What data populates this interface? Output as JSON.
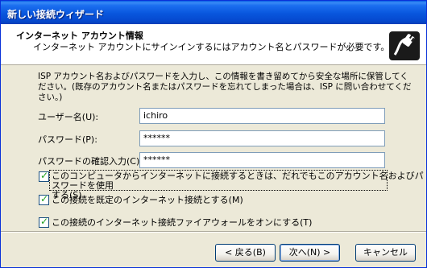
{
  "window": {
    "title": "新しい接続ウィザード"
  },
  "header": {
    "title": "インターネット アカウント情報",
    "subtitle": "インターネット アカウントにサインインするにはアカウント名とパスワードが必要です。",
    "icon": "network-plug-icon"
  },
  "description": "ISP アカウント名およびパスワードを入力し、この情報を書き留めてから安全な場所に保管してください。(既存のアカウント名またはパスワードを忘れてしまった場合は、ISP に問い合わせてください。)",
  "fields": {
    "username": {
      "label": "ユーザー名(U):",
      "value": "ichiro"
    },
    "password": {
      "label": "パスワード(P):",
      "value": "******"
    },
    "confirm": {
      "label": "パスワードの確認入力(C):",
      "value": "******"
    }
  },
  "checkboxes": [
    {
      "label_line1": "このコンピュータからインターネットに接続するときは、だれでもこのアカウント名およびパスワードを使用",
      "label_line2": "する(S)",
      "checked": true
    },
    {
      "label_line1": "この接続を既定のインターネット接続とする(M)",
      "label_line2": "",
      "checked": true
    },
    {
      "label_line1": "この接続のインターネット接続ファイアウォールをオンにする(T)",
      "label_line2": "",
      "checked": true
    }
  ],
  "buttons": {
    "back": "< 戻る(B)",
    "next": "次へ(N) >",
    "cancel": "キャンセル"
  },
  "colors": {
    "title_bar": "#0856dd",
    "dialog_bg": "#ece9d8",
    "checkmark": "#21a121"
  }
}
